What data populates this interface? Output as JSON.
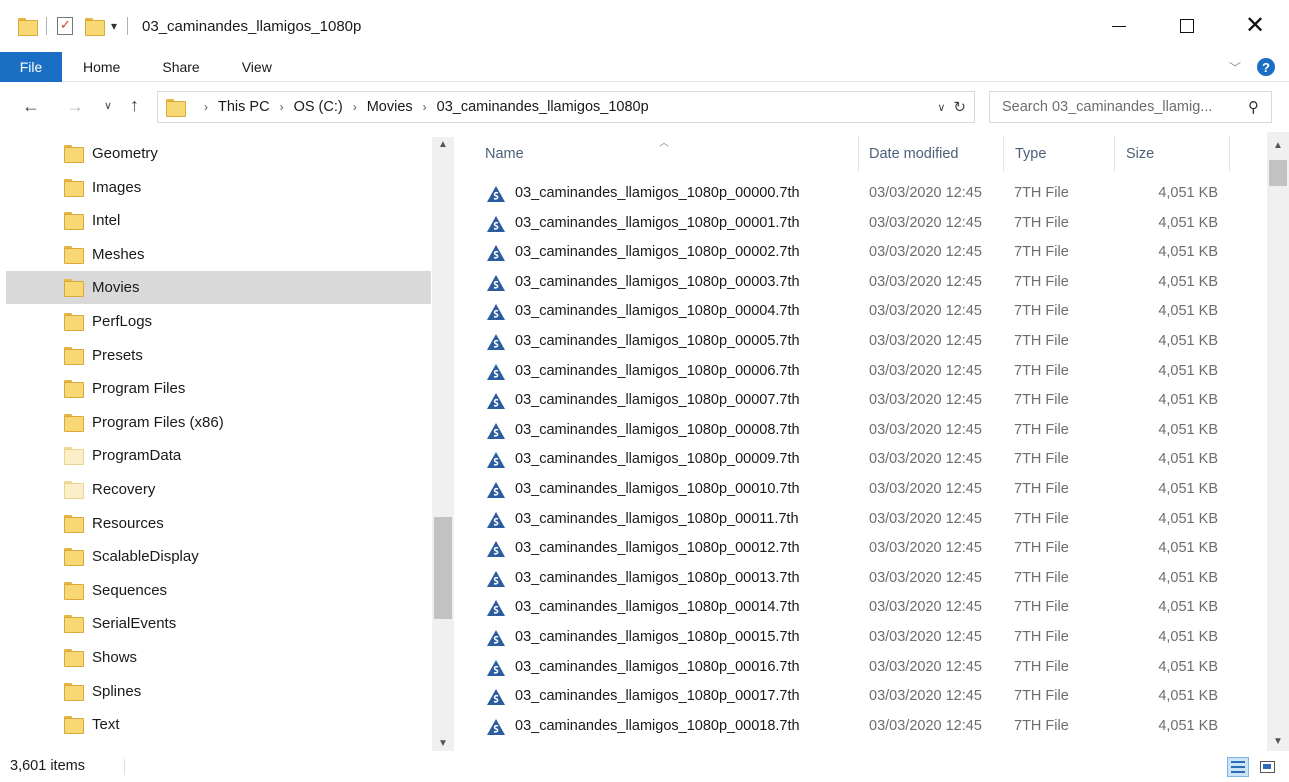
{
  "window": {
    "title": "03_caminandes_llamigos_1080p",
    "min_glyph": "",
    "close_glyph": "✕"
  },
  "ribbon": {
    "tabs": [
      "File",
      "Home",
      "Share",
      "View"
    ],
    "help": "?"
  },
  "address": {
    "crumbs": [
      "This PC",
      "OS (C:)",
      "Movies",
      "03_caminandes_llamigos_1080p"
    ]
  },
  "search": {
    "placeholder": "Search 03_caminandes_llamig..."
  },
  "nav_pane": {
    "items": [
      {
        "label": "Geometry",
        "icon": "folder-icon",
        "pale": false
      },
      {
        "label": "Images",
        "icon": "folder-icon",
        "pale": false
      },
      {
        "label": "Intel",
        "icon": "folder-icon",
        "pale": false
      },
      {
        "label": "Meshes",
        "icon": "folder-icon",
        "pale": false
      },
      {
        "label": "Movies",
        "icon": "folder-icon",
        "pale": false,
        "selected": true
      },
      {
        "label": "PerfLogs",
        "icon": "folder-icon",
        "pale": false
      },
      {
        "label": "Presets",
        "icon": "folder-icon",
        "pale": false
      },
      {
        "label": "Program Files",
        "icon": "folder-icon",
        "pale": false
      },
      {
        "label": "Program Files (x86)",
        "icon": "folder-icon",
        "pale": false
      },
      {
        "label": "ProgramData",
        "icon": "folder-icon",
        "pale": true
      },
      {
        "label": "Recovery",
        "icon": "folder-icon",
        "pale": true
      },
      {
        "label": "Resources",
        "icon": "folder-icon",
        "pale": false
      },
      {
        "label": "ScalableDisplay",
        "icon": "folder-icon",
        "pale": false
      },
      {
        "label": "Sequences",
        "icon": "folder-icon",
        "pale": false
      },
      {
        "label": "SerialEvents",
        "icon": "folder-icon",
        "pale": false
      },
      {
        "label": "Shows",
        "icon": "folder-icon",
        "pale": false
      },
      {
        "label": "Splines",
        "icon": "folder-icon",
        "pale": false
      },
      {
        "label": "Text",
        "icon": "folder-icon",
        "pale": false
      }
    ]
  },
  "file_list": {
    "columns": {
      "name": "Name",
      "date": "Date modified",
      "type": "Type",
      "size": "Size"
    },
    "rows": [
      {
        "name": "03_caminandes_llamigos_1080p_00000.7th",
        "date": "03/03/2020 12:45",
        "type": "7TH File",
        "size": "4,051 KB"
      },
      {
        "name": "03_caminandes_llamigos_1080p_00001.7th",
        "date": "03/03/2020 12:45",
        "type": "7TH File",
        "size": "4,051 KB"
      },
      {
        "name": "03_caminandes_llamigos_1080p_00002.7th",
        "date": "03/03/2020 12:45",
        "type": "7TH File",
        "size": "4,051 KB"
      },
      {
        "name": "03_caminandes_llamigos_1080p_00003.7th",
        "date": "03/03/2020 12:45",
        "type": "7TH File",
        "size": "4,051 KB"
      },
      {
        "name": "03_caminandes_llamigos_1080p_00004.7th",
        "date": "03/03/2020 12:45",
        "type": "7TH File",
        "size": "4,051 KB"
      },
      {
        "name": "03_caminandes_llamigos_1080p_00005.7th",
        "date": "03/03/2020 12:45",
        "type": "7TH File",
        "size": "4,051 KB"
      },
      {
        "name": "03_caminandes_llamigos_1080p_00006.7th",
        "date": "03/03/2020 12:45",
        "type": "7TH File",
        "size": "4,051 KB"
      },
      {
        "name": "03_caminandes_llamigos_1080p_00007.7th",
        "date": "03/03/2020 12:45",
        "type": "7TH File",
        "size": "4,051 KB"
      },
      {
        "name": "03_caminandes_llamigos_1080p_00008.7th",
        "date": "03/03/2020 12:45",
        "type": "7TH File",
        "size": "4,051 KB"
      },
      {
        "name": "03_caminandes_llamigos_1080p_00009.7th",
        "date": "03/03/2020 12:45",
        "type": "7TH File",
        "size": "4,051 KB"
      },
      {
        "name": "03_caminandes_llamigos_1080p_00010.7th",
        "date": "03/03/2020 12:45",
        "type": "7TH File",
        "size": "4,051 KB"
      },
      {
        "name": "03_caminandes_llamigos_1080p_00011.7th",
        "date": "03/03/2020 12:45",
        "type": "7TH File",
        "size": "4,051 KB"
      },
      {
        "name": "03_caminandes_llamigos_1080p_00012.7th",
        "date": "03/03/2020 12:45",
        "type": "7TH File",
        "size": "4,051 KB"
      },
      {
        "name": "03_caminandes_llamigos_1080p_00013.7th",
        "date": "03/03/2020 12:45",
        "type": "7TH File",
        "size": "4,051 KB"
      },
      {
        "name": "03_caminandes_llamigos_1080p_00014.7th",
        "date": "03/03/2020 12:45",
        "type": "7TH File",
        "size": "4,051 KB"
      },
      {
        "name": "03_caminandes_llamigos_1080p_00015.7th",
        "date": "03/03/2020 12:45",
        "type": "7TH File",
        "size": "4,051 KB"
      },
      {
        "name": "03_caminandes_llamigos_1080p_00016.7th",
        "date": "03/03/2020 12:45",
        "type": "7TH File",
        "size": "4,051 KB"
      },
      {
        "name": "03_caminandes_llamigos_1080p_00017.7th",
        "date": "03/03/2020 12:45",
        "type": "7TH File",
        "size": "4,051 KB"
      },
      {
        "name": "03_caminandes_llamigos_1080p_00018.7th",
        "date": "03/03/2020 12:45",
        "type": "7TH File",
        "size": "4,051 KB"
      }
    ],
    "file_icon": "7th-file-icon",
    "icon_color": "#2b5c9e"
  },
  "status": {
    "item_count": "3,601 items"
  },
  "colors": {
    "accent": "#1a6fc4",
    "folder": "#f8d775",
    "selection": "#d9d9d9"
  }
}
